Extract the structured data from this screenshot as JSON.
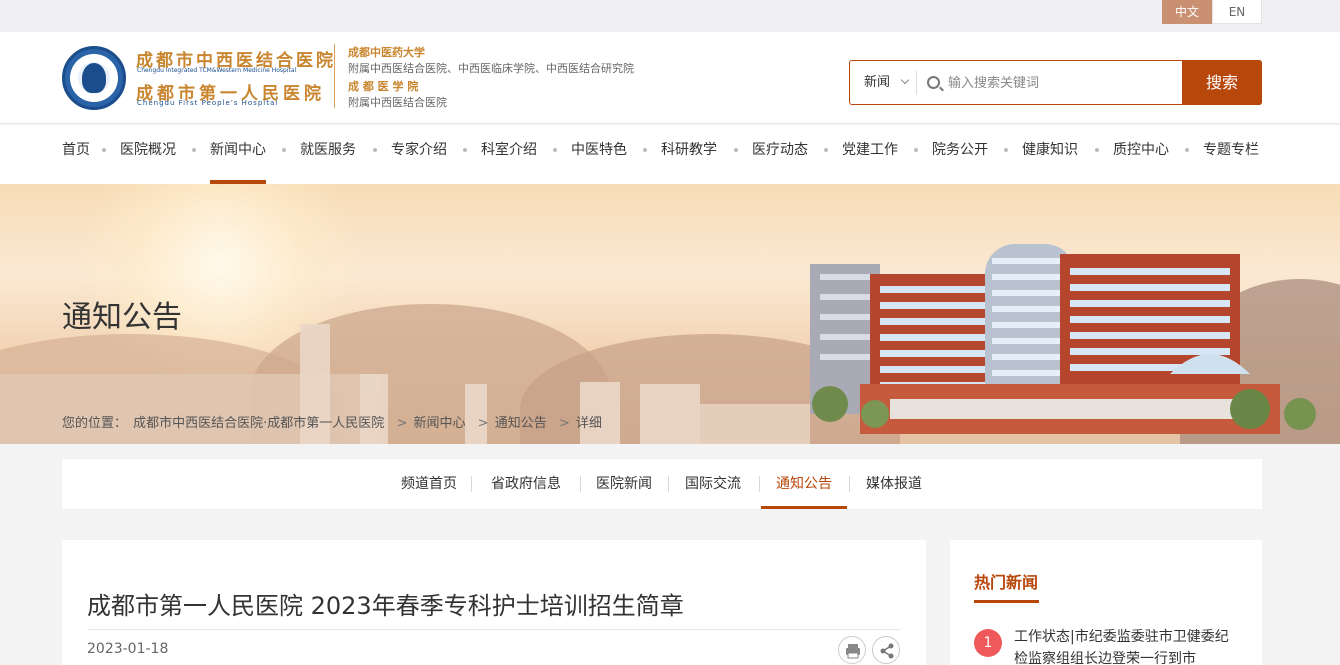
{
  "lang": {
    "zh": "中文",
    "en": "EN"
  },
  "logo": {
    "name_cn_1": "成都市中西医结合医院",
    "name_en_1": "Chengdu Integrated TCM&Western Medicine Hospital",
    "name_cn_2": "成都市第一人民医院",
    "name_en_2": "Chengdu First People's Hospital",
    "aff_1_title": "成都中医药大学",
    "aff_1_sub": "附属中西医结合医院、中西医临床学院、中西医结合研究院",
    "aff_2_title": "成 都 医 学 院",
    "aff_2_sub": "附属中西医结合医院"
  },
  "search": {
    "category": "新闻",
    "placeholder": "输入搜索关键词",
    "button": "搜索"
  },
  "nav": {
    "items": [
      "首页",
      "医院概况",
      "新闻中心",
      "就医服务",
      "专家介绍",
      "科室介绍",
      "中医特色",
      "科研教学",
      "医疗动态",
      "党建工作",
      "院务公开",
      "健康知识",
      "质控中心",
      "专题专栏"
    ],
    "active": "新闻中心"
  },
  "banner": {
    "title": "通知公告",
    "breadcrumb_label": "您的位置：",
    "breadcrumb": [
      "成都市中西医结合医院·成都市第一人民医院",
      "新闻中心",
      "通知公告",
      "详细"
    ]
  },
  "subtabs": {
    "items": [
      "频道首页",
      "省政府信息",
      "医院新闻",
      "国际交流",
      "通知公告",
      "媒体报道"
    ],
    "active": "通知公告"
  },
  "article": {
    "title": "成都市第一人民医院 2023年春季专科护士培训招生简章",
    "date": "2023-01-18"
  },
  "sidebar": {
    "title": "热门新闻",
    "hot": [
      {
        "rank": "1",
        "text": "工作状态|市纪委监委驻市卫健委纪检监察组组长边登荣一行到市"
      }
    ]
  },
  "colors": {
    "accent": "#b8470c",
    "gold": "#c9862f",
    "blue": "#1b4d8c",
    "hot_badge": "#f0595b"
  }
}
